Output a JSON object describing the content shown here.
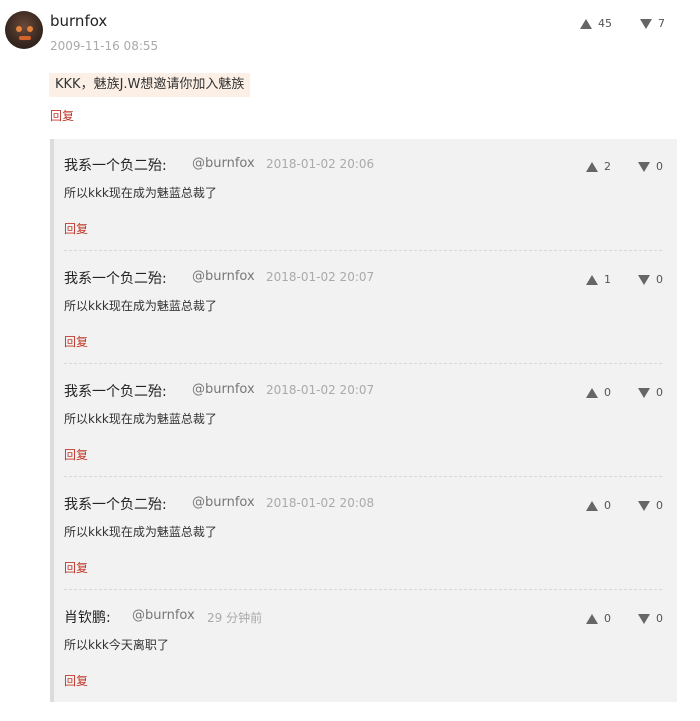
{
  "main": {
    "author": "burnfox",
    "time": "2009-11-16 08:55",
    "upvotes": "45",
    "downvotes": "7",
    "content": "KKK，魅族J.W想邀请你加入魅族",
    "reply_label": "回复"
  },
  "replies": [
    {
      "author": "我系一个负二殆:",
      "mention": "@burnfox",
      "time": "2018-01-02 20:06",
      "text": "所以kkk现在成为魅蓝总裁了",
      "up": "2",
      "down": "0",
      "reply_label": "回复"
    },
    {
      "author": "我系一个负二殆:",
      "mention": "@burnfox",
      "time": "2018-01-02 20:07",
      "text": "所以kkk现在成为魅蓝总裁了",
      "up": "1",
      "down": "0",
      "reply_label": "回复"
    },
    {
      "author": "我系一个负二殆:",
      "mention": "@burnfox",
      "time": "2018-01-02 20:07",
      "text": "所以kkk现在成为魅蓝总裁了",
      "up": "0",
      "down": "0",
      "reply_label": "回复"
    },
    {
      "author": "我系一个负二殆:",
      "mention": "@burnfox",
      "time": "2018-01-02 20:08",
      "text": "所以kkk现在成为魅蓝总裁了",
      "up": "0",
      "down": "0",
      "reply_label": "回复"
    },
    {
      "author": "肖钦鹏:",
      "mention": "@burnfox",
      "time": "29 分钟前",
      "text": "所以kkk今天离职了",
      "up": "0",
      "down": "0",
      "reply_label": "回复"
    }
  ],
  "colors": {
    "accent_red": "#c0392b",
    "thread_bg": "#f2f2f2",
    "quote_bg": "#fbefe6"
  },
  "icons": {
    "upvote": "triangle-up-icon",
    "downvote": "triangle-down-icon"
  }
}
